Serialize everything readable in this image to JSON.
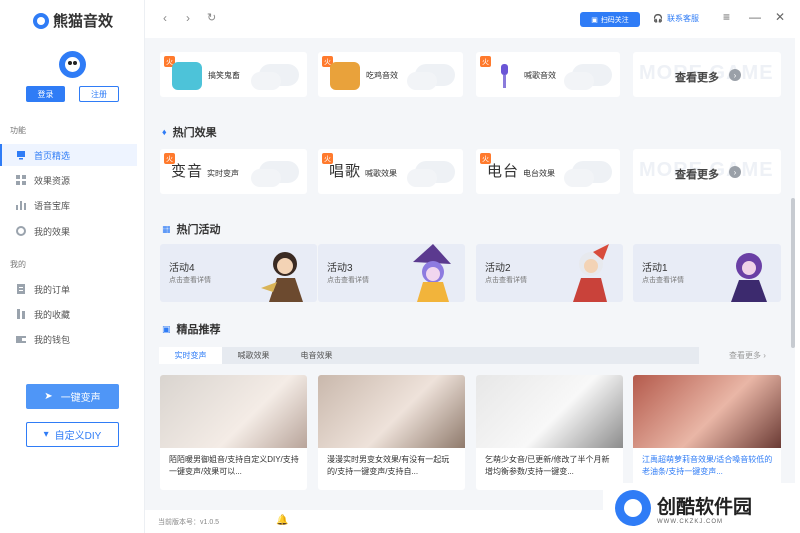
{
  "app": {
    "title": "熊猫音效"
  },
  "user": {
    "login_label": "登录",
    "register_label": "注册"
  },
  "sidebar": {
    "section1": "功能",
    "section2": "我的",
    "items": [
      {
        "label": "首页精选",
        "icon": "monitor-icon"
      },
      {
        "label": "效果资源",
        "icon": "grid-icon"
      },
      {
        "label": "语音宝库",
        "icon": "bar-chart-icon"
      },
      {
        "label": "我的效果",
        "icon": "settings-icon"
      },
      {
        "label": "我的订单",
        "icon": "list-icon"
      },
      {
        "label": "我的收藏",
        "icon": "bookmark-icon"
      },
      {
        "label": "我的钱包",
        "icon": "wallet-icon"
      }
    ],
    "voice_change_label": "一键变声",
    "diy_label": "自定义DIY"
  },
  "topbar": {
    "scan_label": "扫码关注",
    "service_label": "联系客服"
  },
  "row1": [
    {
      "label": "搞笑鬼畜"
    },
    {
      "label": "吃鸡音效"
    },
    {
      "label": "喊歌音效"
    }
  ],
  "view_more": "查看更多",
  "more_bg": "MORE GAME",
  "hot_effects": {
    "title": "热门效果",
    "items": [
      {
        "word": "变音",
        "label": "实时变声"
      },
      {
        "word": "唱歌",
        "label": "喊歌效果"
      },
      {
        "word": "电台",
        "label": "电台效果"
      }
    ]
  },
  "hot_activities": {
    "title": "热门活动",
    "items": [
      {
        "title": "活动4",
        "sub": "点击查看详情"
      },
      {
        "title": "活动3",
        "sub": "点击查看详情"
      },
      {
        "title": "活动2",
        "sub": "点击查看详情"
      },
      {
        "title": "活动1",
        "sub": "点击查看详情"
      }
    ]
  },
  "recommend": {
    "title": "精品推荐",
    "tabs": [
      "实时变声",
      "喊歌效果",
      "电音效果"
    ],
    "more": "查看更多",
    "items": [
      {
        "text": "陌陌暖男御姐音/支持自定义DIY/支持一键变声/效果可以..."
      },
      {
        "text": "漫漫实时男变女效果/有没有一起玩的/支持一键变声/支持自..."
      },
      {
        "text": "乞萌少女音/已更新/修改了半个月新增均衡参数/支持一键变..."
      },
      {
        "text": "江禹超萌萝莉音效果/适合嗓音较低的老油条/支持一键变声..."
      }
    ]
  },
  "footer": {
    "version": "当前版本号：v1.0.5"
  },
  "watermark": {
    "title": "创酷软件园",
    "url": "WWW.CKZKJ.COM"
  },
  "colors": {
    "accent": "#2f7cf6",
    "hot": "#ff7a2d",
    "bg": "#f4f6f9"
  }
}
